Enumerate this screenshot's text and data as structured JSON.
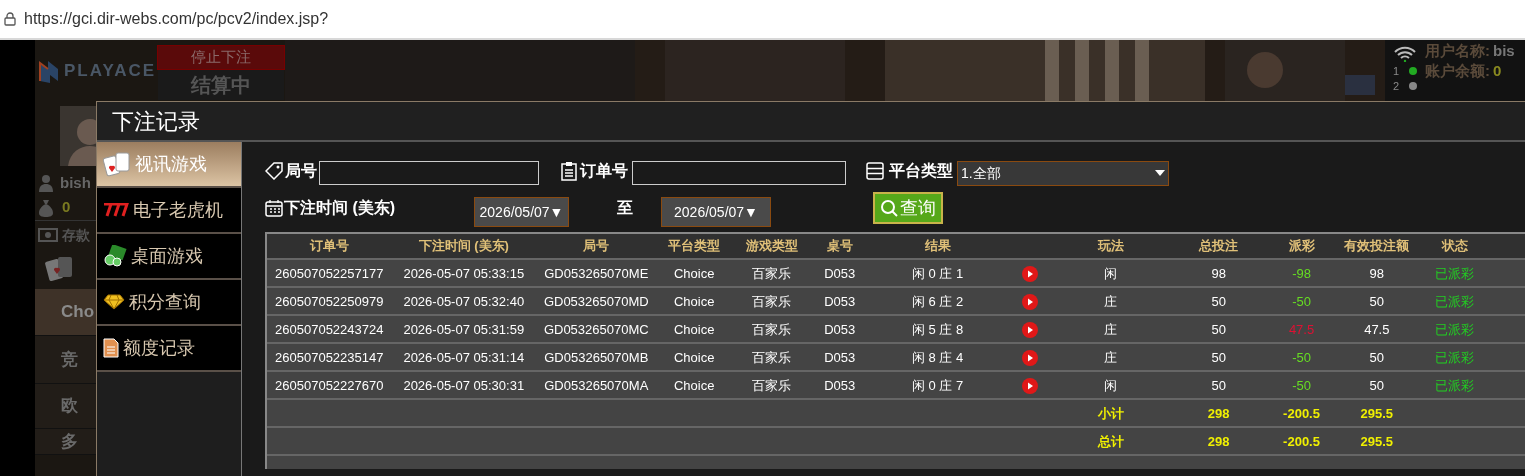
{
  "browser": {
    "url": "https://gci.dir-webs.com/pc/pcv2/index.jsp?"
  },
  "background": {
    "logo": "PLAYACE",
    "stop_banner": "停止下注",
    "settling": "结算中",
    "username": "bish",
    "balance": "0",
    "deposit": "存款",
    "menu": [
      {
        "label": "Cho",
        "selected": true
      },
      {
        "label": "竞",
        "selected": false
      },
      {
        "label": "欧",
        "selected": false
      },
      {
        "label": "多",
        "selected": false
      }
    ],
    "info": [
      {
        "label": "用户名称:",
        "value": "bis"
      },
      {
        "label": "账户余额:",
        "value": "0"
      }
    ],
    "lines": [
      {
        "label": "1",
        "color": "#22aa22"
      },
      {
        "label": "2",
        "color": "#888888"
      }
    ]
  },
  "dialog": {
    "title": "下注记录",
    "sidebar": [
      {
        "label": "视讯游戏",
        "selected": true,
        "kind": "cards"
      },
      {
        "label": "电子老虎机",
        "selected": false,
        "kind": "slots"
      },
      {
        "label": "桌面游戏",
        "selected": false,
        "kind": "chips"
      },
      {
        "label": "积分查询",
        "selected": false,
        "kind": "diamond"
      },
      {
        "label": "额度记录",
        "selected": false,
        "kind": "document"
      }
    ],
    "filters": {
      "round_label": "局号",
      "order_label": "订单号",
      "platform_label": "平台类型",
      "platform_value": "1.全部",
      "time_label": "下注时间 (美东)",
      "date_from": "2026/05/07▼",
      "to_label": "至",
      "date_to": "2026/05/07▼",
      "query_button": "查询"
    },
    "table": {
      "columns": [
        "订单号",
        "下注时间 (美东)",
        "局号",
        "平台类型",
        "游戏类型",
        "桌号",
        "结果",
        "",
        "玩法",
        "总投注",
        "派彩",
        "有效投注额",
        "状态"
      ],
      "rows": [
        {
          "order_no": "260507052257177",
          "bet_time": "2026-05-07 05:33:15",
          "round_no": "GD053265070ME",
          "platform": "Choice",
          "game_type": "百家乐",
          "table_no": "D053",
          "result": "闲 0 庄 1",
          "bet_on": "闲",
          "total_bet": "98",
          "payout": "-98",
          "color": "#66dd22",
          "valid_bet": "98",
          "status": "已派彩"
        },
        {
          "order_no": "260507052250979",
          "bet_time": "2026-05-07 05:32:40",
          "round_no": "GD053265070MD",
          "platform": "Choice",
          "game_type": "百家乐",
          "table_no": "D053",
          "result": "闲 6 庄 2",
          "bet_on": "庄",
          "total_bet": "50",
          "payout": "-50",
          "color": "#66dd22",
          "valid_bet": "50",
          "status": "已派彩"
        },
        {
          "order_no": "260507052243724",
          "bet_time": "2026-05-07 05:31:59",
          "round_no": "GD053265070MC",
          "platform": "Choice",
          "game_type": "百家乐",
          "table_no": "D053",
          "result": "闲 5 庄 8",
          "bet_on": "庄",
          "total_bet": "50",
          "payout": "47.5",
          "color": "#dd1133",
          "valid_bet": "47.5",
          "status": "已派彩"
        },
        {
          "order_no": "260507052235147",
          "bet_time": "2026-05-07 05:31:14",
          "round_no": "GD053265070MB",
          "platform": "Choice",
          "game_type": "百家乐",
          "table_no": "D053",
          "result": "闲 8 庄 4",
          "bet_on": "庄",
          "total_bet": "50",
          "payout": "-50",
          "color": "#66dd22",
          "valid_bet": "50",
          "status": "已派彩"
        },
        {
          "order_no": "260507052227670",
          "bet_time": "2026-05-07 05:30:31",
          "round_no": "GD053265070MA",
          "platform": "Choice",
          "game_type": "百家乐",
          "table_no": "D053",
          "result": "闲 0 庄 7",
          "bet_on": "闲",
          "total_bet": "50",
          "payout": "-50",
          "color": "#66dd22",
          "valid_bet": "50",
          "status": "已派彩"
        }
      ],
      "totals": [
        {
          "label": "小计",
          "total_bet": "298",
          "payout": "-200.5",
          "valid_bet": "295.5"
        },
        {
          "label": "总计",
          "total_bet": "298",
          "payout": "-200.5",
          "valid_bet": "295.5"
        }
      ]
    }
  }
}
